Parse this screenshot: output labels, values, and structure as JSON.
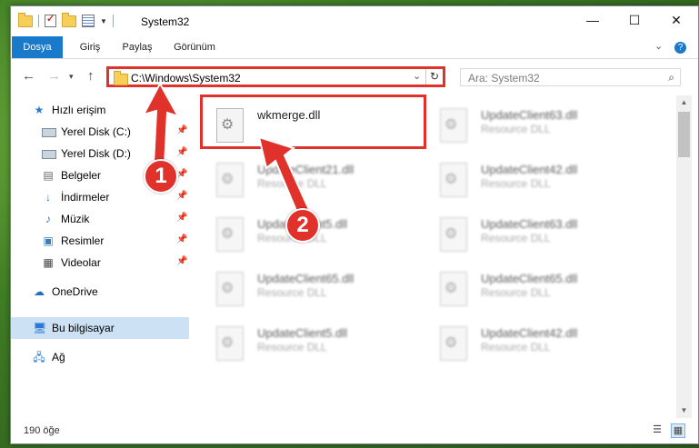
{
  "window": {
    "title": "System32",
    "controls": {
      "minimize": "—",
      "maximize": "☐",
      "close": "✕"
    }
  },
  "ribbon": {
    "tabs": [
      "Dosya",
      "Giriş",
      "Paylaş",
      "Görünüm"
    ],
    "expand": "⌄",
    "help": "?"
  },
  "address": {
    "path": "C:\\Windows\\System32",
    "refresh": "↻"
  },
  "search": {
    "placeholder": "Ara: System32"
  },
  "sidebar": {
    "items": [
      {
        "label": "Hızlı erişim",
        "icon": "star-icon"
      },
      {
        "label": "Yerel Disk (C:)",
        "icon": "drive-icon"
      },
      {
        "label": "Yerel Disk (D:)",
        "icon": "drive-icon"
      },
      {
        "label": "Belgeler",
        "icon": "documents-icon"
      },
      {
        "label": "İndirmeler",
        "icon": "download-icon"
      },
      {
        "label": "Müzik",
        "icon": "music-icon"
      },
      {
        "label": "Resimler",
        "icon": "pictures-icon"
      },
      {
        "label": "Videolar",
        "icon": "video-icon"
      },
      {
        "label": "OneDrive",
        "icon": "cloud-icon"
      },
      {
        "label": "Bu bilgisayar",
        "icon": "computer-icon"
      },
      {
        "label": "Ağ",
        "icon": "network-icon"
      }
    ]
  },
  "files": [
    {
      "name": "wkmerge.dll",
      "type": ""
    },
    {
      "name": "UpdateClient63.dll",
      "type": "Resource DLL"
    },
    {
      "name": "UpdateClient21.dll",
      "type": "Resource DLL"
    },
    {
      "name": "UpdateClient42.dll",
      "type": "Resource DLL"
    },
    {
      "name": "UpdateClient5.dll",
      "type": "Resource DLL"
    },
    {
      "name": "UpdateClient63.dll",
      "type": "Resource DLL"
    },
    {
      "name": "UpdateClient65.dll",
      "type": "Resource DLL"
    },
    {
      "name": "UpdateClient65.dll",
      "type": "Resource DLL"
    },
    {
      "name": "UpdateClient5.dll",
      "type": "Resource DLL"
    },
    {
      "name": "UpdateClient42.dll",
      "type": "Resource DLL"
    }
  ],
  "status": {
    "count": "190 öğe"
  },
  "annotations": {
    "step1": "1",
    "step2": "2",
    "color": "#e0312b"
  }
}
